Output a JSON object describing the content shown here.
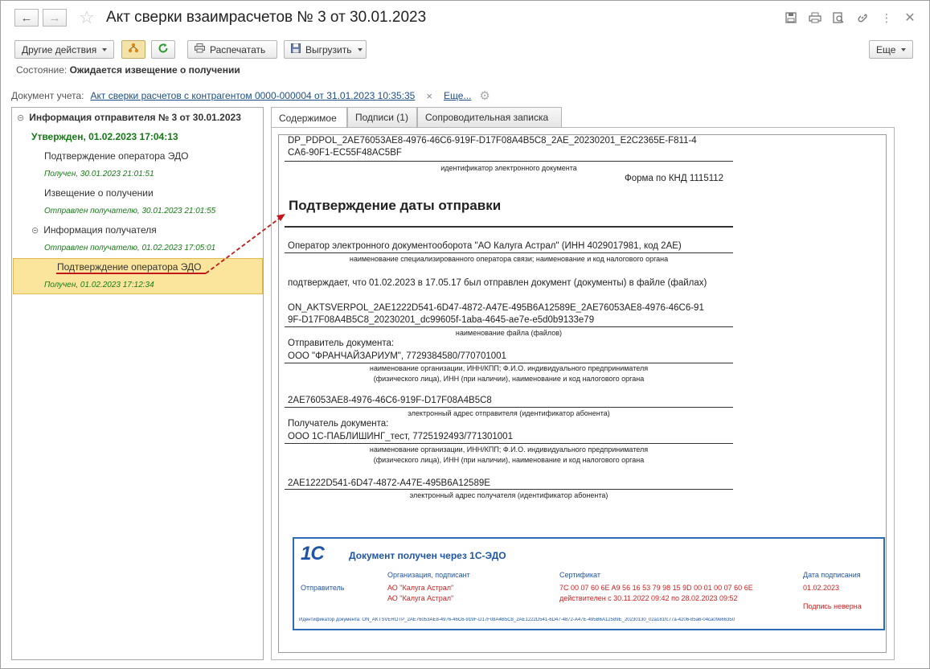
{
  "window": {
    "title": "Акт сверки взаимрасчетов № 3 от 30.01.2023",
    "back_icon": "arrow-left-icon",
    "forward_icon": "arrow-right-icon",
    "favorite_icon": "star-icon"
  },
  "toolbar": {
    "other_actions": "Другие действия",
    "print": "Распечатать",
    "export": "Выгрузить",
    "more": "Еще"
  },
  "state": {
    "label": "Состояние:",
    "value": "Ожидается извещение о получении"
  },
  "doc_account": {
    "label": "Документ учета:",
    "link": "Акт сверки расчетов с контрагентом 0000-000004 от 31.01.2023 10:35:35",
    "more": "Еще..."
  },
  "tree": {
    "root": "Информация отправителя № 3 от 30.01.2023",
    "approved": "Утвержден, 01.02.2023 17:04:13",
    "items": [
      {
        "label": "Подтверждение оператора ЭДО",
        "sub": "Получен, 30.01.2023 21:01:51"
      },
      {
        "label": "Извещение о получении",
        "sub": "Отправлен получателю, 30.01.2023 21:01:55"
      }
    ],
    "recipient": {
      "label": "Информация получателя",
      "sub": "Отправлен получателю, 01.02.2023 17:05:01"
    },
    "selected": {
      "label": "Подтверждение оператора ЭДО",
      "sub": "Получен, 01.02.2023 17:12:34"
    }
  },
  "tabs": [
    {
      "label": "Содержимое"
    },
    {
      "label": "Подписи (1)"
    },
    {
      "label": "Сопроводительная записка"
    }
  ],
  "document": {
    "id_line1": "DP_PDPOL_2AE76053AE8-4976-46C6-919F-D17F08A4B5C8_2AE_20230201_E2C2365E-F811-4",
    "id_line2": "CA6-90F1-EC55F48AC5BF",
    "id_caption": "идентификатор электронного документа",
    "form": "Форма по КНД 1115112",
    "heading": "Подтверждение даты отправки",
    "operator": "Оператор электронного документооборота \"АО Калуга Астрал\" (ИНН 4029017981, код 2АЕ)",
    "operator_caption": "наименование специализированного оператора связи; наименование и код налогового органа",
    "confirms": "подтверждает, что 01.02.2023 в 17.05.17 был отправлен документ (документы) в файле (файлах)",
    "file_line1": "ON_AKTSVERPOL_2AE1222D541-6D47-4872-A47E-495B6A12589E_2AE76053AE8-4976-46C6-91",
    "file_line2": "9F-D17F08A4B5C8_20230201_dc99605f-1aba-4645-ae7e-e5d0b9133e79",
    "file_caption": "наименование файла (файлов)",
    "sender_label": "Отправитель документа:",
    "sender_value": "ООО \"ФРАНЧАЙЗАРИУМ\", 7729384580/770701001",
    "org_caption1": "наименование организации, ИНН/КПП; Ф.И.О. индивидуального предпринимателя",
    "org_caption2": "(физического лица), ИНН (при наличии), наименование и код налогового органа",
    "sender_id": "2AE76053AE8-4976-46C6-919F-D17F08A4B5C8",
    "sender_id_caption": "электронный адрес отправителя (идентификатор абонента)",
    "recipient_label": "Получатель документа:",
    "recipient_value": "ООО 1С-ПАБЛИШИНГ_тест, 7725192493/771301001",
    "recipient_id": "2AE1222D541-6D47-4872-A47E-495B6A12589E",
    "recipient_id_caption": "электронный адрес получателя (идентификатор абонента)"
  },
  "stamp": {
    "logo": "1С",
    "title": "Документ получен через 1С-ЭДО",
    "col_org": "Организация, подписант",
    "col_cert": "Сертификат",
    "col_date": "Дата подписания",
    "role": "Отправитель",
    "org1": "АО \"Калуга Астрал\"",
    "org2": "АО \"Калуга Астрал\"",
    "cert": "7C 00 07 60 6E A9 56 16 53 79 98 15 9D 00 01 00 07 60 6E",
    "cert_valid": "действителен с 30.11.2022 09:42 по 28.02.2023 09:52",
    "date": "01.02.2023",
    "signature_status": "Подпись неверна",
    "doc_id": "Идентификатор документа: ON_AKTSVEROTP_2AE76053AE8-4976-46C6-919F-D17F08A4B5C8_2AE1222D541-6D47-4872-A47E-495B6A12589E_20230130_02a181fc77a-4206-85a6-04ca09e66350",
    "colors": {
      "border": "#2e6db5",
      "red": "#d01f1f"
    }
  },
  "colors": {
    "accent_green": "#157a15",
    "selection": "#fbe59c",
    "annotation_red": "#c0191c"
  }
}
